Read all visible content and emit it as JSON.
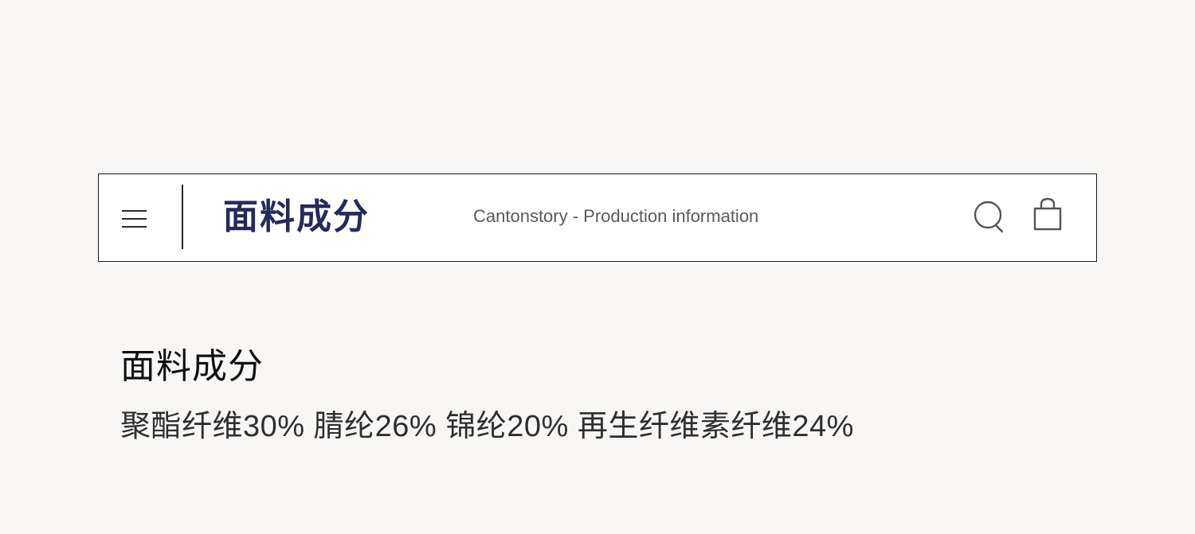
{
  "header": {
    "title": "面料成分",
    "subtitle": "Cantonstory - Production information",
    "icons": [
      "menu-icon",
      "search-icon",
      "shopping-bag-icon"
    ],
    "colors": {
      "title": "#232a5e",
      "subtitle": "#5a5a5a",
      "border": "#1a1a1a"
    }
  },
  "section": {
    "heading": "面料成分",
    "composition": "聚酯纤维30% 腈纶26% 锦纶20% 再生纤维素纤维24%"
  },
  "page": {
    "background": "#f8f7f5"
  }
}
